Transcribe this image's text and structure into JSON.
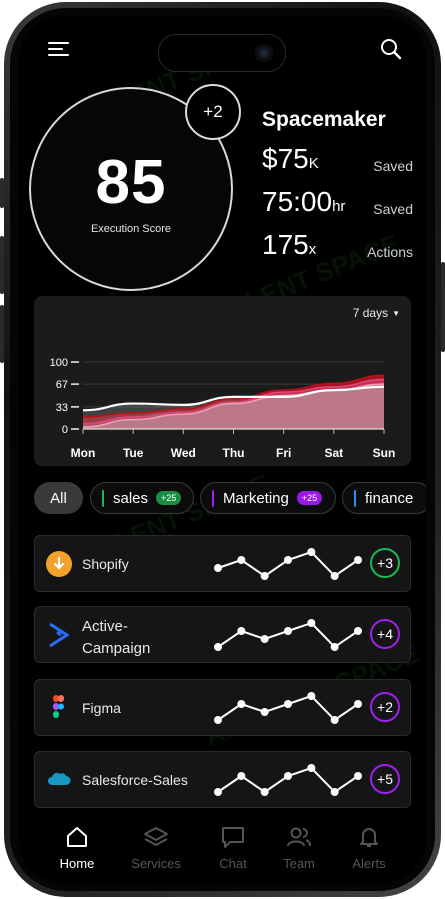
{
  "header": {
    "menu_icon": "hamburger-menu-icon",
    "search_icon": "search-icon"
  },
  "score": {
    "value": "85",
    "label": "Execution Score",
    "delta": "+2"
  },
  "summary": {
    "brand": "Spacemaker",
    "metrics": [
      {
        "value": "$75",
        "unit": "K",
        "label": "Saved"
      },
      {
        "value": "75:00",
        "unit": "hr",
        "label": "Saved"
      },
      {
        "value": "175",
        "unit": "x",
        "label": "Actions"
      }
    ]
  },
  "chart_data": {
    "type": "area",
    "range_label": "7 days",
    "categories": [
      "Mon",
      "Tue",
      "Wed",
      "Thu",
      "Fri",
      "Sat",
      "Sun"
    ],
    "y_ticks": [
      "100",
      "67",
      "33",
      "0"
    ],
    "ylim": [
      0,
      100
    ],
    "grid": true,
    "series": [
      {
        "color": "#b5121b",
        "values": [
          18,
          24,
          30,
          45,
          58,
          68,
          80
        ]
      },
      {
        "color": "#e0457b",
        "values": [
          8,
          18,
          25,
          40,
          55,
          63,
          74
        ]
      },
      {
        "color": "#e8a0b4",
        "values": [
          3,
          14,
          22,
          38,
          50,
          58,
          67
        ]
      },
      {
        "color": "#ffffff",
        "values": [
          28,
          38,
          36,
          48,
          48,
          58,
          63
        ]
      }
    ]
  },
  "filters": {
    "all": "All",
    "items": [
      {
        "label": "sales",
        "count": "+25",
        "color": "#1db954"
      },
      {
        "label": "Marketing",
        "count": "+25",
        "color": "#a020f0"
      },
      {
        "label": "finance",
        "count": "",
        "color": "#2f8fff"
      }
    ]
  },
  "integrations": [
    {
      "name": "Shopify",
      "icon": "shopify-icon",
      "count": "+3",
      "color": "#1db954",
      "trend": [
        2,
        3,
        1,
        3,
        4,
        1,
        3
      ]
    },
    {
      "name": "Active-\nCampaign",
      "line1": "Active-",
      "line2": "Campaign",
      "icon": "activecampaign-icon",
      "count": "+4",
      "color": "#a020f0",
      "trend": [
        1,
        3,
        2,
        3,
        4,
        1,
        3
      ]
    },
    {
      "name": "Figma",
      "icon": "figma-icon",
      "count": "+2",
      "color": "#a020f0",
      "trend": [
        1,
        3,
        2,
        3,
        4,
        1,
        3
      ]
    },
    {
      "name": "Salesforce-Sales",
      "icon": "salesforce-icon",
      "count": "+5",
      "color": "#a020f0",
      "trend": [
        1,
        3,
        1,
        3,
        4,
        1,
        3
      ]
    }
  ],
  "tabs": [
    {
      "label": "Home",
      "icon": "home-icon",
      "active": true
    },
    {
      "label": "Services",
      "icon": "layers-icon",
      "active": false
    },
    {
      "label": "Chat",
      "icon": "chat-icon",
      "active": false
    },
    {
      "label": "Team",
      "icon": "team-icon",
      "active": false
    },
    {
      "label": "Alerts",
      "icon": "bell-icon",
      "active": false
    }
  ],
  "watermark": "AI TALENT SPACE"
}
